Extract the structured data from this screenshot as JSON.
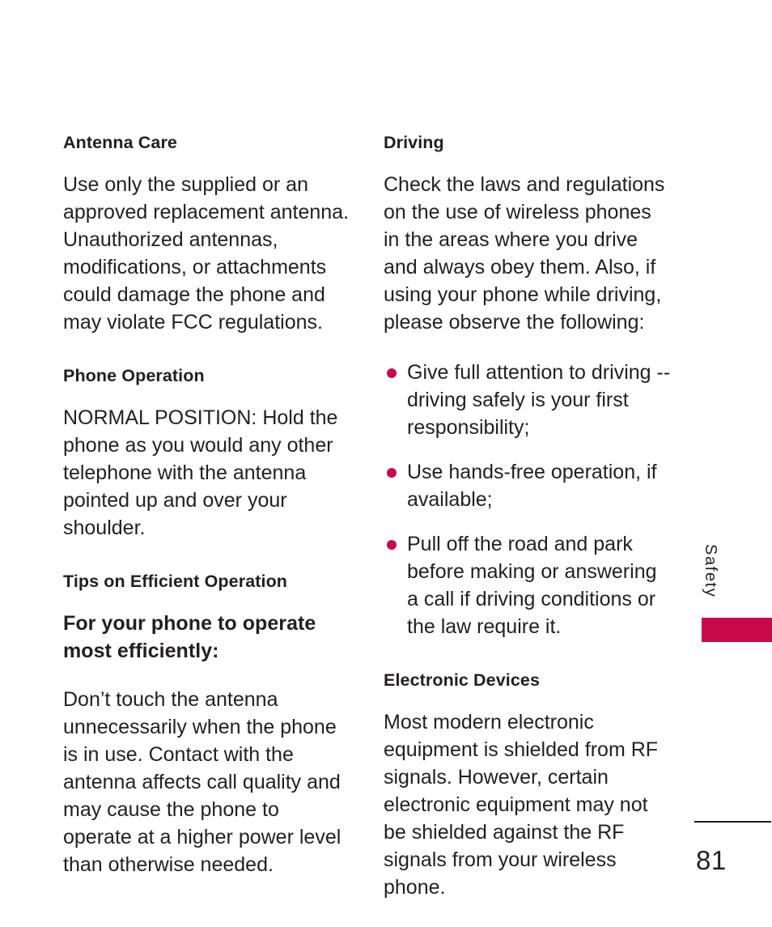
{
  "page": {
    "number": "81",
    "side_tab_label": "Safety",
    "accent_color": "#c80a4b",
    "text_color": "#231f20",
    "background_color": "#ffffff"
  },
  "left_column": {
    "sections": [
      {
        "heading": "Antenna Care",
        "paragraphs": [
          "Use only the supplied or an approved replacement antenna. Unauthorized antennas, modifications, or attachments could damage the phone and may violate FCC regulations."
        ]
      },
      {
        "heading": "Phone Operation",
        "paragraphs": [
          "NORMAL POSITION: Hold the phone as you would any other telephone with the antenna pointed up and over your shoulder."
        ]
      },
      {
        "heading": "Tips on Efficient Operation",
        "lead": "For your phone to operate most efficiently:",
        "paragraphs": [
          "Don’t touch the antenna unnecessarily when the phone is in use. Contact with the antenna affects call quality and may cause the phone to operate at a higher power level than otherwise needed."
        ]
      }
    ]
  },
  "right_column": {
    "sections": [
      {
        "heading": "Driving",
        "paragraphs": [
          "Check the laws and regulations on the use of wireless phones in the areas where you drive and always obey them. Also, if using your phone while driving, please observe the following:"
        ],
        "bullets": [
          "Give full attention to driving -- driving safely is your first responsibility;",
          "Use hands-free operation, if available;",
          "Pull off the road and park before making or answering a call if driving conditions or the law require it."
        ]
      },
      {
        "heading": "Electronic Devices",
        "paragraphs": [
          "Most modern electronic equipment is shielded from RF signals. However, certain electronic equipment may not be shielded against the RF signals from your wireless phone."
        ]
      }
    ]
  }
}
